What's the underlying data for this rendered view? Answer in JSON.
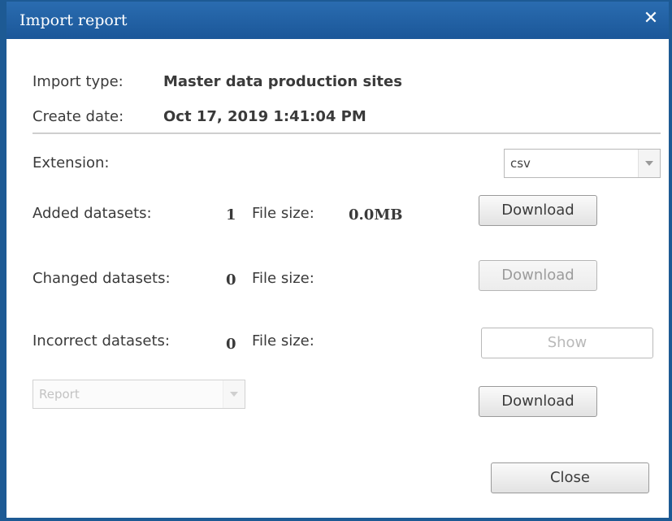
{
  "dialog": {
    "title": "Import report",
    "close_glyph": "✕"
  },
  "info": {
    "import_type_label": "Import type:",
    "import_type_value": "Master data production sites",
    "create_date_label": "Create date:",
    "create_date_value": "Oct 17, 2019 1:41:04 PM"
  },
  "extension": {
    "label": "Extension:",
    "selected": "csv"
  },
  "added": {
    "label": "Added datasets:",
    "count": "1",
    "file_size_label": "File size:",
    "file_size_value": "0.0MB",
    "button_label": "Download"
  },
  "changed": {
    "label": "Changed datasets:",
    "count": "0",
    "file_size_label": "File size:",
    "file_size_value": "",
    "button_label": "Download"
  },
  "incorrect": {
    "label": "Incorrect datasets:",
    "count": "0",
    "file_size_label": "File size:",
    "file_size_value": "",
    "button_label": "Show"
  },
  "report": {
    "selected": "Report",
    "button_label": "Download"
  },
  "footer": {
    "close_label": "Close"
  },
  "colors": {
    "titlebar": "#1d5a94",
    "title_text": "#ffffff"
  }
}
